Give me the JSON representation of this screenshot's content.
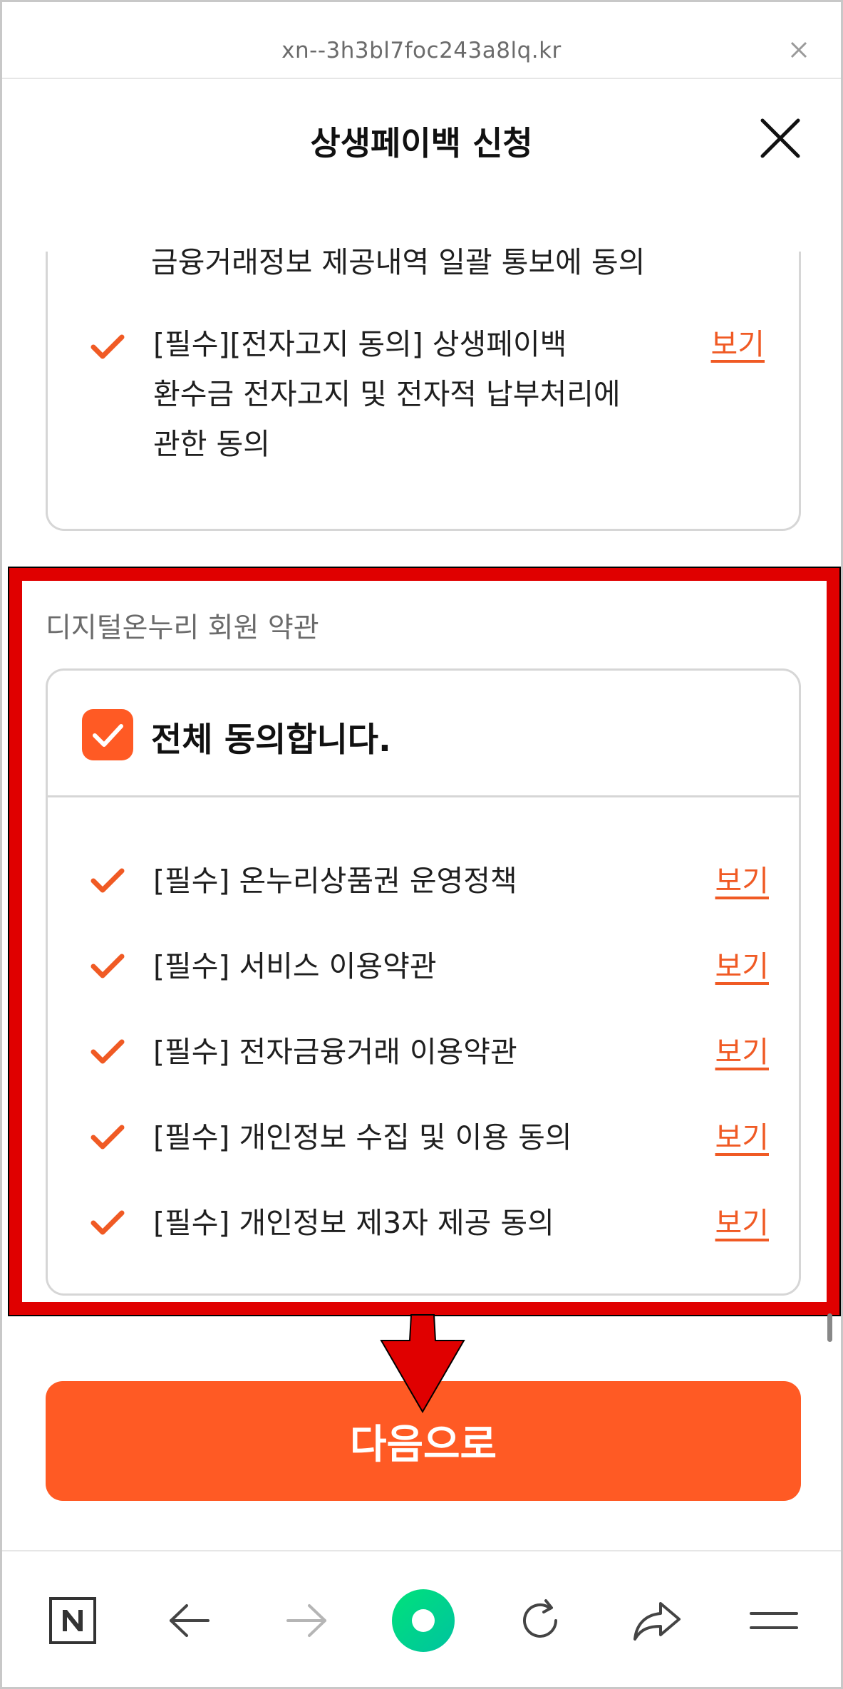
{
  "urlbar": {
    "url": "xn--3h3bl7foc243a8lq.kr",
    "close_icon": "close-icon"
  },
  "header": {
    "title": "상생페이백 신청",
    "close_icon": "close-icon"
  },
  "previous_section": {
    "continued_text": "금융거래정보 제공내역 일괄 통보에 동의",
    "items": [
      {
        "lines": [
          "[필수][전자고지 동의] 상생페이백",
          "환수금 전자고지 및 전자적 납부처리에",
          "관한 동의"
        ],
        "view_label": "보기"
      }
    ]
  },
  "onnuri_section": {
    "title": "디지털온누리 회원 약관",
    "agree_all_label": "전체 동의합니다.",
    "agree_all_checked": true,
    "items": [
      {
        "label": "[필수] 온누리상품권 운영정책",
        "view_label": "보기"
      },
      {
        "label": "[필수] 서비스 이용약관",
        "view_label": "보기"
      },
      {
        "label": "[필수] 전자금융거래 이용약관",
        "view_label": "보기"
      },
      {
        "label": "[필수] 개인정보 수집 및 이용 동의",
        "view_label": "보기"
      },
      {
        "label": "[필수] 개인정보 제3자 제공 동의",
        "view_label": "보기"
      }
    ]
  },
  "next_button_label": "다음으로",
  "colors": {
    "accent": "#ff5a24",
    "link": "#f05a24",
    "highlight": "#e00000",
    "nav_green": "#00d36b"
  },
  "bottom_nav": [
    "naver-icon",
    "back-arrow-icon",
    "forward-arrow-icon",
    "home-circle-icon",
    "refresh-icon",
    "share-icon",
    "menu-icon"
  ]
}
